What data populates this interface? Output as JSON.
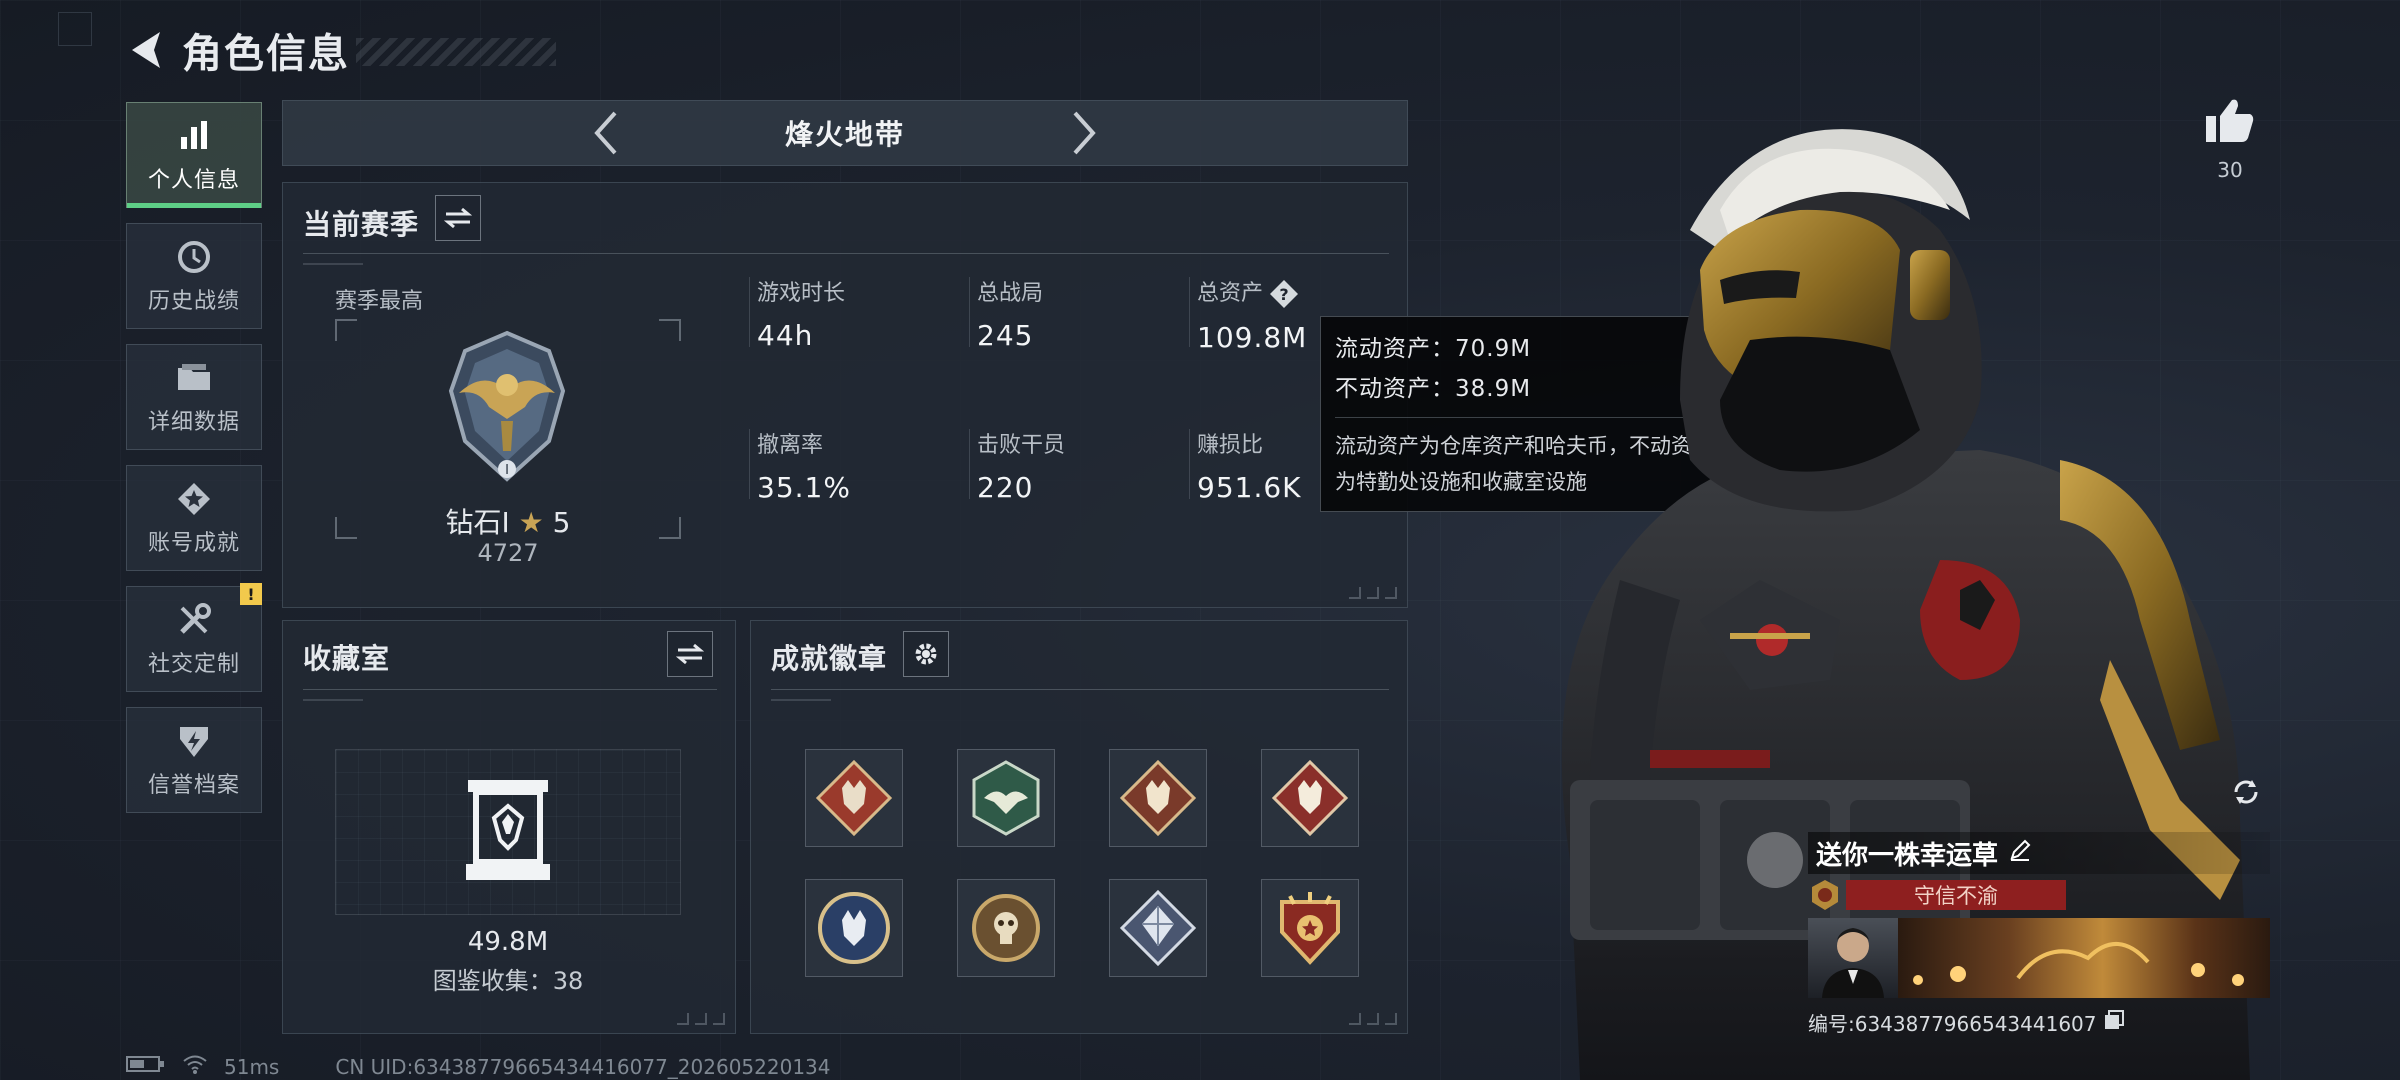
{
  "header": {
    "title": "角色信息"
  },
  "sidebar": {
    "items": [
      {
        "label": "个人信息",
        "icon": "bar-chart-icon",
        "active": true
      },
      {
        "label": "历史战绩",
        "icon": "history-icon"
      },
      {
        "label": "详细数据",
        "icon": "folder-icon"
      },
      {
        "label": "账号成就",
        "icon": "star-badge-icon"
      },
      {
        "label": "社交定制",
        "icon": "tools-icon",
        "badge": "!"
      },
      {
        "label": "信誉档案",
        "icon": "shield-icon"
      }
    ]
  },
  "mode": {
    "title": "烽火地带"
  },
  "season": {
    "title": "当前赛季",
    "subtitle": "赛季最高",
    "rank_name": "钻石Ⅰ",
    "rank_stars": "5",
    "rank_score": "4727",
    "stats": [
      {
        "label": "游戏时长",
        "value": "44h"
      },
      {
        "label": "总战局",
        "value": "245"
      },
      {
        "label": "总资产",
        "value": "109.8M"
      },
      {
        "label": "撤离率",
        "value": "35.1%"
      },
      {
        "label": "击败干员",
        "value": "220"
      },
      {
        "label": "赚损比",
        "value": "951.6K"
      }
    ]
  },
  "tooltip": {
    "liquid": "流动资产：70.9M",
    "fixed": "不动资产：38.9M",
    "desc_line1": "流动资产为仓库资产和哈夫币，不动资产",
    "desc_line2": "为特勤处设施和收藏室设施"
  },
  "collection": {
    "title": "收藏室",
    "value": "49.8M",
    "count": "图鉴收集：38"
  },
  "achievements": {
    "title": "成就徽章",
    "badges": [
      {
        "icon": "wolf-diamond-badge-icon",
        "color": "#9a3a2c"
      },
      {
        "icon": "eagle-hexagon-badge-icon",
        "color": "#2f5a48"
      },
      {
        "icon": "wolf-diamond-badge-icon",
        "color": "#7a3a2a"
      },
      {
        "icon": "wolf-diamond-badge-icon",
        "color": "#8a2f2a"
      },
      {
        "icon": "wolf-circle-badge-icon",
        "color": "#2a3f66"
      },
      {
        "icon": "skull-circle-badge-icon",
        "color": "#6a5030"
      },
      {
        "icon": "crystal-diamond-badge-icon",
        "color": "#4a5670"
      },
      {
        "icon": "star-shield-badge-icon",
        "color": "#8a2a22"
      }
    ]
  },
  "like": {
    "count": "30"
  },
  "card": {
    "title": "送你一株幸运草",
    "tag": "守信不渝",
    "id": "编号:6343877966543441607"
  },
  "footer": {
    "ping": "51ms",
    "uid": "CN UID:6343877966543441607​7_202605220134"
  },
  "colors": {
    "accent": "#5ecf87",
    "warning": "#f2c94c",
    "tag_red": "#8e1f1f"
  }
}
